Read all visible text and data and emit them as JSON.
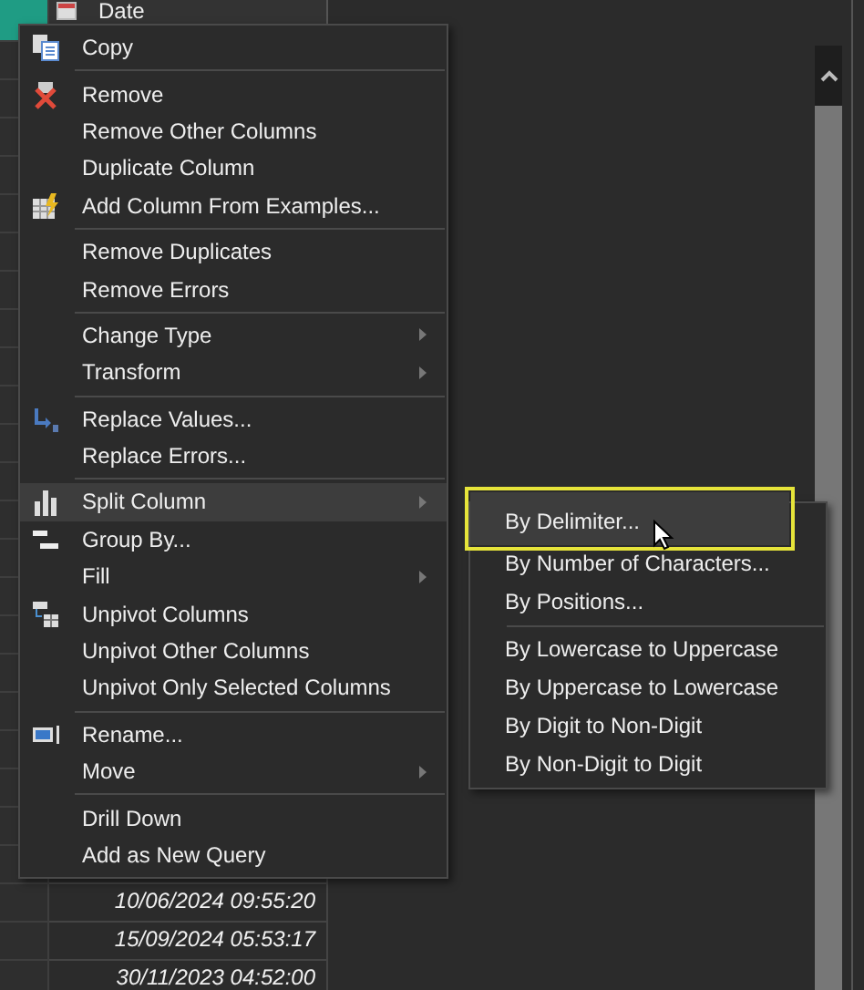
{
  "grid": {
    "header": "Date",
    "rows": [
      "10/06/2024 09:55:20",
      "15/09/2024 05:53:17",
      "30/11/2023 04:52:00"
    ]
  },
  "context_menu": {
    "groups": [
      [
        {
          "label": "Copy",
          "submenu": false,
          "selected": false
        }
      ],
      [
        {
          "label": "Remove",
          "submenu": false,
          "selected": false
        },
        {
          "label": "Remove Other Columns",
          "submenu": false,
          "selected": false
        },
        {
          "label": "Duplicate Column",
          "submenu": false,
          "selected": false
        },
        {
          "label": "Add Column From Examples...",
          "submenu": false,
          "selected": false
        }
      ],
      [
        {
          "label": "Remove Duplicates",
          "submenu": false,
          "selected": false
        },
        {
          "label": "Remove Errors",
          "submenu": false,
          "selected": false
        }
      ],
      [
        {
          "label": "Change Type",
          "submenu": true,
          "selected": false
        },
        {
          "label": "Transform",
          "submenu": true,
          "selected": false
        }
      ],
      [
        {
          "label": "Replace Values...",
          "submenu": false,
          "selected": false
        },
        {
          "label": "Replace Errors...",
          "submenu": false,
          "selected": false
        }
      ],
      [
        {
          "label": "Split Column",
          "submenu": true,
          "selected": true
        },
        {
          "label": "Group By...",
          "submenu": false,
          "selected": false
        },
        {
          "label": "Fill",
          "submenu": true,
          "selected": false
        },
        {
          "label": "Unpivot Columns",
          "submenu": false,
          "selected": false
        },
        {
          "label": "Unpivot Other Columns",
          "submenu": false,
          "selected": false
        },
        {
          "label": "Unpivot Only Selected Columns",
          "submenu": false,
          "selected": false
        }
      ],
      [
        {
          "label": "Rename...",
          "submenu": false,
          "selected": false
        },
        {
          "label": "Move",
          "submenu": true,
          "selected": false
        }
      ],
      [
        {
          "label": "Drill Down",
          "submenu": false,
          "selected": false
        },
        {
          "label": "Add as New Query",
          "submenu": false,
          "selected": false
        }
      ]
    ]
  },
  "submenu": {
    "groups": [
      [
        {
          "label": "By Delimiter...",
          "selected": true,
          "highlighted": true
        },
        {
          "label": "By Number of Characters...",
          "selected": false,
          "highlighted": false
        },
        {
          "label": "By Positions...",
          "selected": false,
          "highlighted": false
        }
      ],
      [
        {
          "label": "By Lowercase to Uppercase",
          "selected": false,
          "highlighted": false
        },
        {
          "label": "By Uppercase to Lowercase",
          "selected": false,
          "highlighted": false
        },
        {
          "label": "By Digit to Non-Digit",
          "selected": false,
          "highlighted": false
        },
        {
          "label": "By Non-Digit to Digit",
          "selected": false,
          "highlighted": false
        }
      ]
    ]
  }
}
